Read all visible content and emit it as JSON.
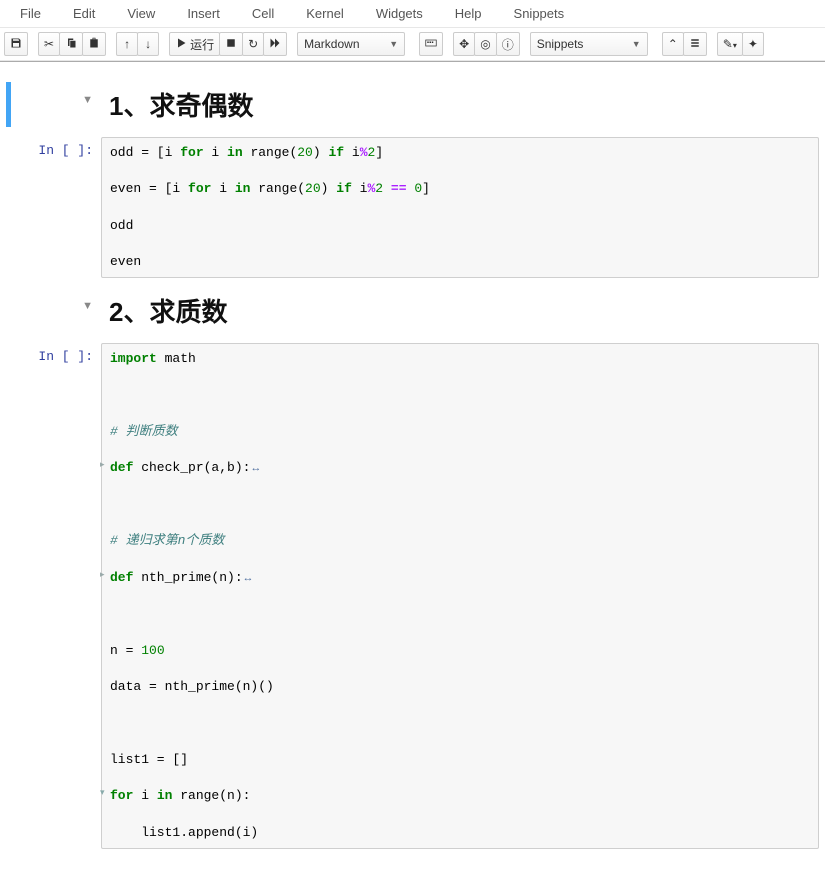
{
  "menu": {
    "items": [
      "File",
      "Edit",
      "View",
      "Insert",
      "Cell",
      "Kernel",
      "Widgets",
      "Help",
      "Snippets"
    ]
  },
  "toolbar": {
    "run_label": "运行",
    "cell_type": "Markdown",
    "snippets_label": "Snippets"
  },
  "cells": {
    "md1_heading": "1、求奇偶数",
    "md2_heading": "2、求质数",
    "prompt_in": "In [ ]:"
  }
}
